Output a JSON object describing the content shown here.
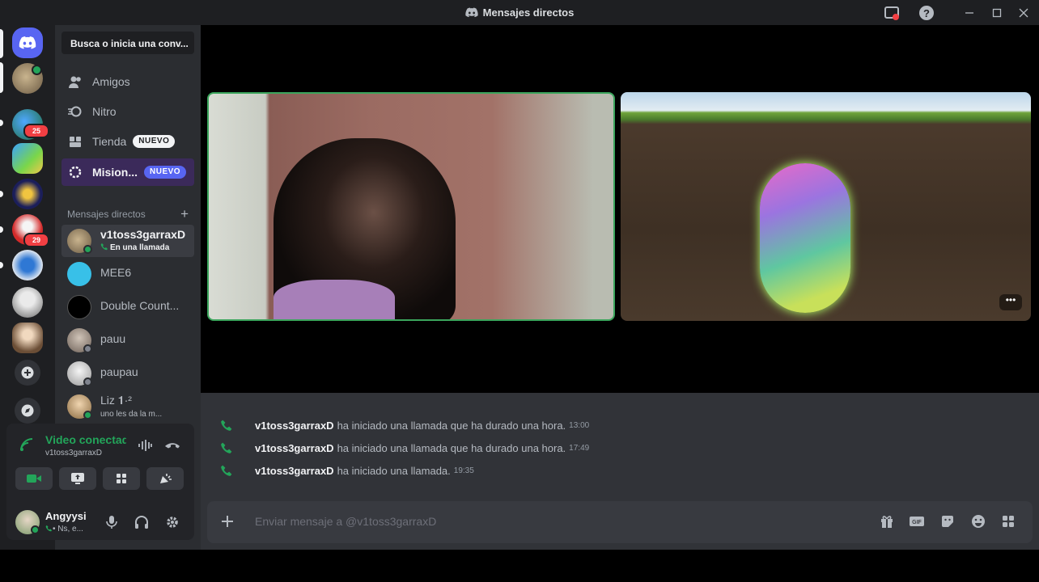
{
  "window": {
    "title": "Mensajes directos"
  },
  "colors": {
    "green": "#23a55a",
    "brand": "#5865f2",
    "red": "#f23f43",
    "nuevo_white": "#f2f3f5",
    "nuevo_blurple": "#5865f2"
  },
  "rail": {
    "badges": [
      "25",
      "29"
    ]
  },
  "sidebar": {
    "search_label": "Busca o inicia una conv...",
    "nav": [
      {
        "label": "Amigos",
        "icon": "friends-icon"
      },
      {
        "label": "Nitro",
        "icon": "nitro-icon"
      },
      {
        "label": "Tienda",
        "icon": "shop-icon",
        "badge": "NUEVO"
      },
      {
        "label": "Mision...",
        "icon": "quests-icon",
        "badge": "NUEVO"
      }
    ],
    "dm_header": "Mensajes directos",
    "dms": [
      {
        "name": "v1toss3garraxD",
        "sub": "En una llamada"
      },
      {
        "name": "MEE6"
      },
      {
        "name": "Double Count..."
      },
      {
        "name": "pauu"
      },
      {
        "name": "paupau"
      },
      {
        "name": "Liz 𝟏·²",
        "sub": "uno les da la m..."
      }
    ]
  },
  "voice": {
    "status": "Video conectado",
    "channel": "v1toss3garraxD"
  },
  "user": {
    "name": "Angyysi",
    "sub": "• Ns, e..."
  },
  "messages": [
    {
      "author": "v1toss3garraxD",
      "text": "ha iniciado una llamada que ha durado una hora.",
      "time": "13:00"
    },
    {
      "author": "v1toss3garraxD",
      "text": "ha iniciado una llamada que ha durado una hora.",
      "time": "17:49"
    },
    {
      "author": "v1toss3garraxD",
      "text": "ha iniciado una llamada.",
      "time": "19:35"
    }
  ],
  "composer": {
    "placeholder": "Enviar mensaje a @v1toss3garraxD"
  }
}
